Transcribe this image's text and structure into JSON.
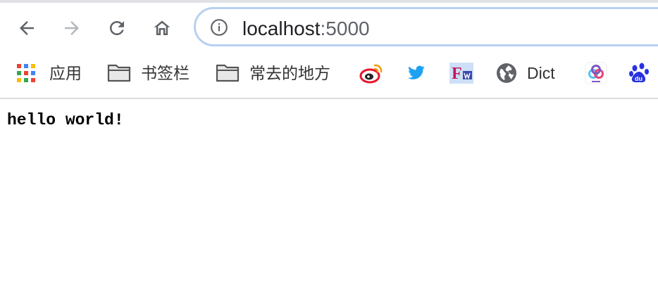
{
  "toolbar": {
    "back_icon": "arrow-left-icon",
    "forward_icon": "arrow-right-icon",
    "reload_icon": "reload-icon",
    "home_icon": "home-icon"
  },
  "omnibox": {
    "host": "localhost",
    "port": ":5000",
    "security_icon": "info-icon"
  },
  "bookmarks": {
    "apps": {
      "label": "应用",
      "icon": "apps-grid-icon"
    },
    "folders": [
      {
        "label": "书签栏",
        "icon": "folder-icon"
      },
      {
        "label": "常去的地方",
        "icon": "folder-icon"
      }
    ],
    "sites": [
      {
        "icon": "weibo-icon"
      },
      {
        "icon": "twitter-icon"
      },
      {
        "icon": "fw-icon",
        "text": "F"
      },
      {
        "label": "Dict",
        "icon": "globe-icon"
      },
      {
        "icon": "colorful-rings-icon"
      },
      {
        "icon": "baidu-paw-icon",
        "text": "du"
      }
    ]
  },
  "page": {
    "text": "hello world!"
  },
  "colors": {
    "omnibox_border": "#b8d0f0",
    "twitter_blue": "#1da1f2",
    "weibo_red": "#e6162d",
    "baidu_blue": "#2932e1"
  }
}
